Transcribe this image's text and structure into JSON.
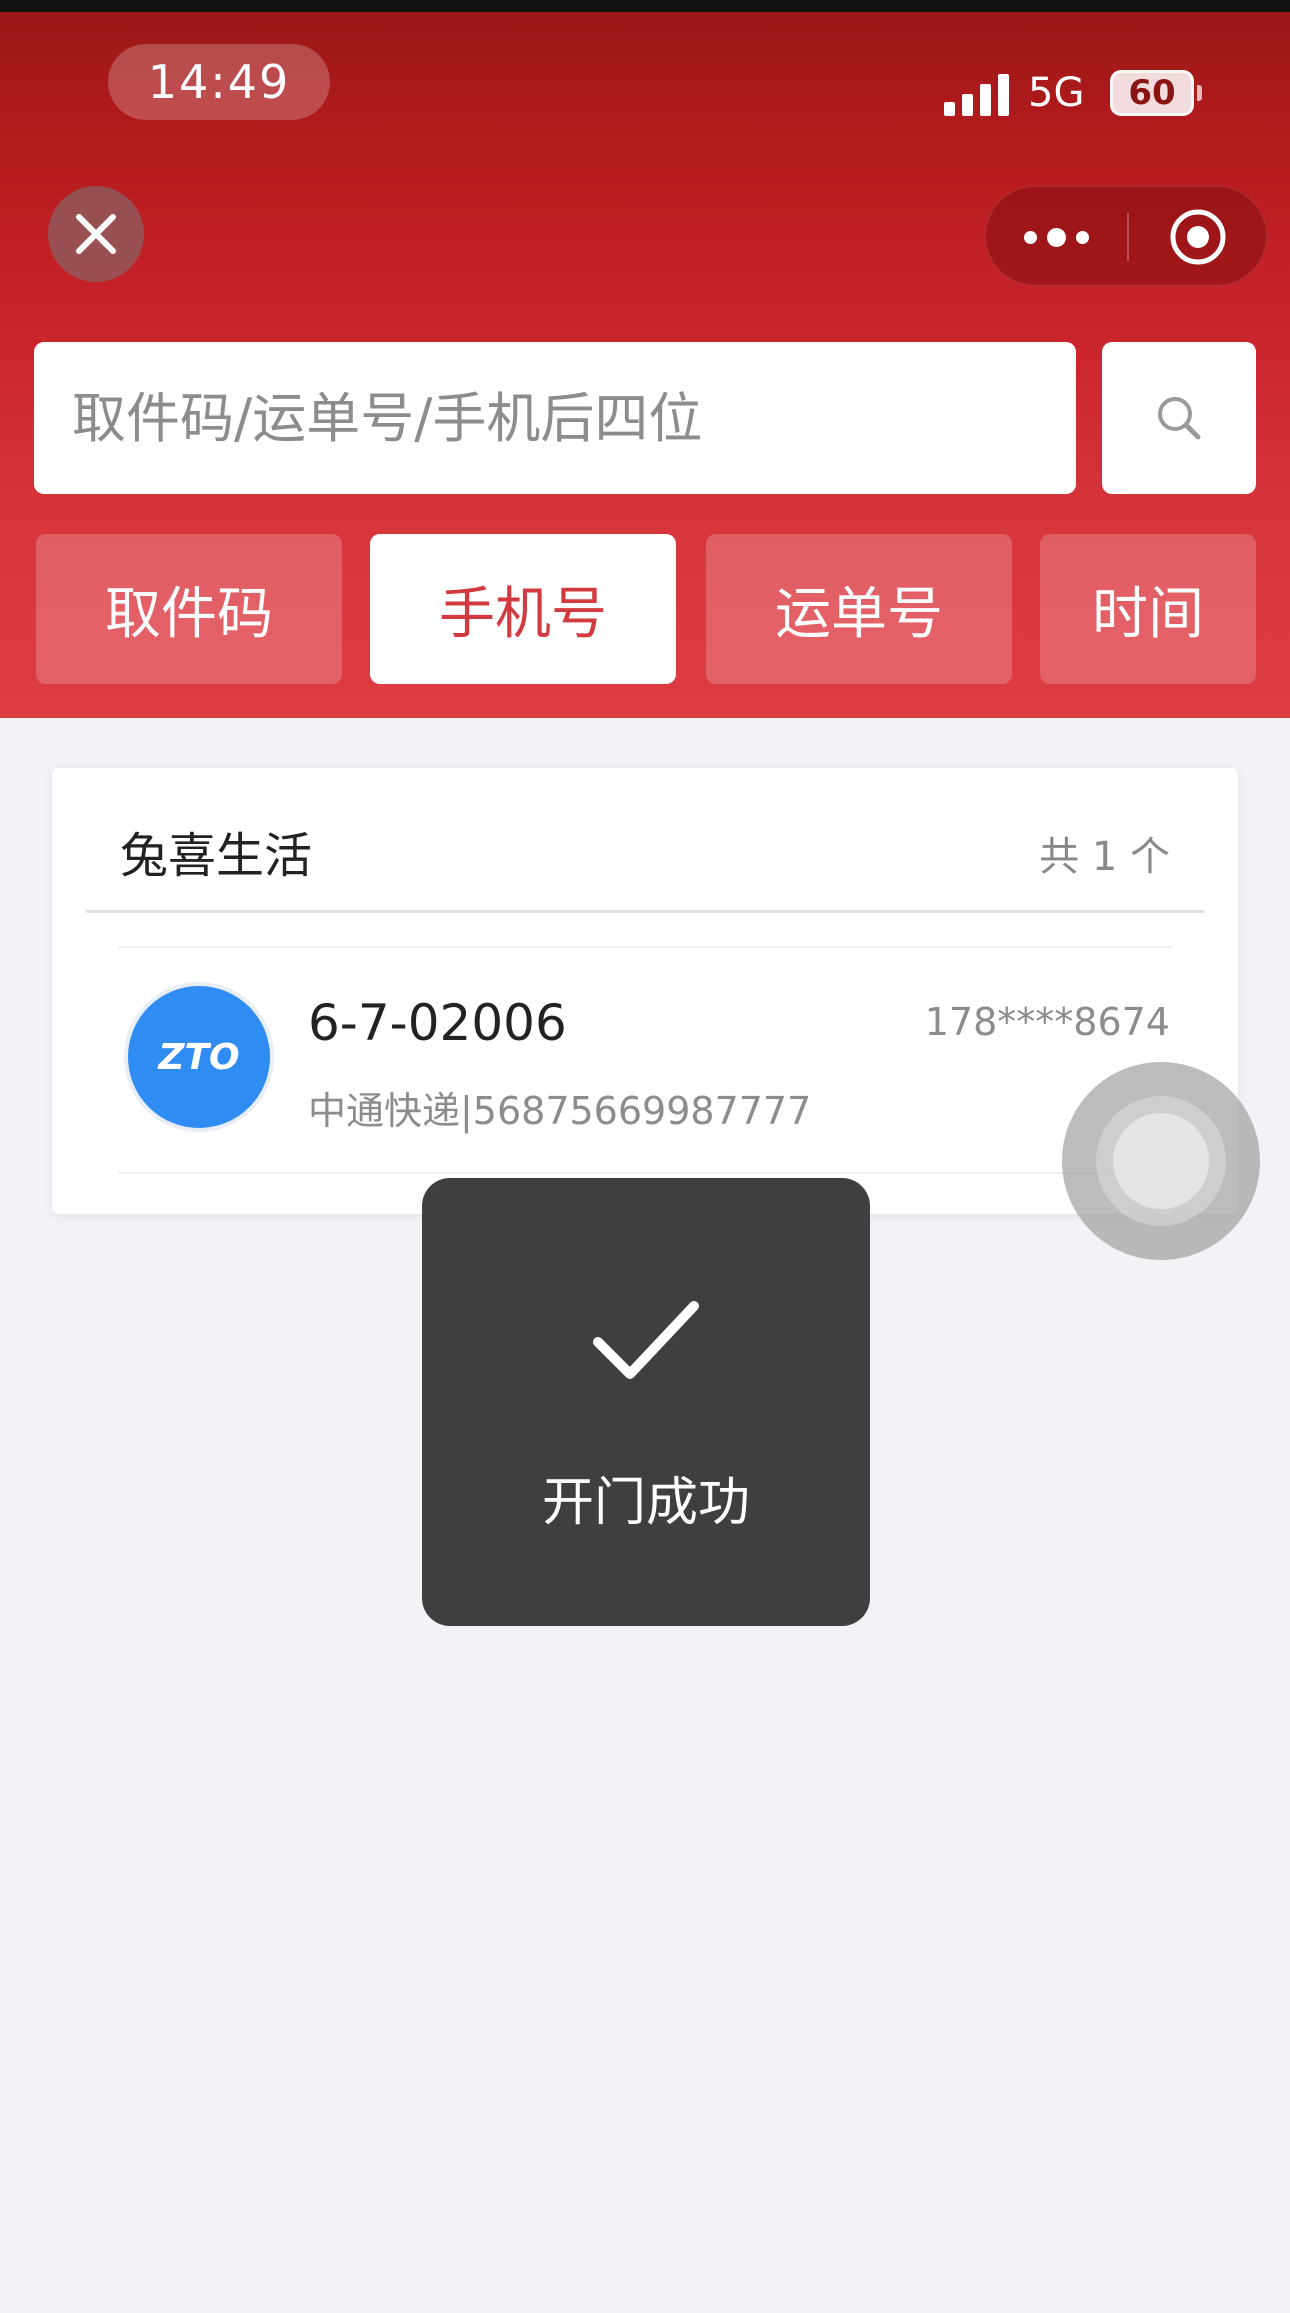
{
  "status_bar": {
    "time": "14:49",
    "network": "5G",
    "battery": "60"
  },
  "header": {
    "search": {
      "placeholder": "取件码/运单号/手机后四位",
      "value": ""
    },
    "tabs": [
      {
        "label": "取件码",
        "active": false
      },
      {
        "label": "手机号",
        "active": true
      },
      {
        "label": "运单号",
        "active": false
      },
      {
        "label": "时间",
        "active": false
      }
    ]
  },
  "card": {
    "title": "兔喜生活",
    "count": "共 1 个",
    "items": [
      {
        "pickup_code": "6-7-02006",
        "carrier_info": "中通快递|56875669987777",
        "phone": "178****8674",
        "logo_text": "ZTO"
      }
    ]
  },
  "toast": {
    "text": "开门成功",
    "icon": "check-icon"
  },
  "colors": {
    "header_red": "#c8222a",
    "active_tab_text": "#d23a3f",
    "carrier_logo_blue": "#2f8cf2",
    "toast_bg": "#3a383a"
  }
}
